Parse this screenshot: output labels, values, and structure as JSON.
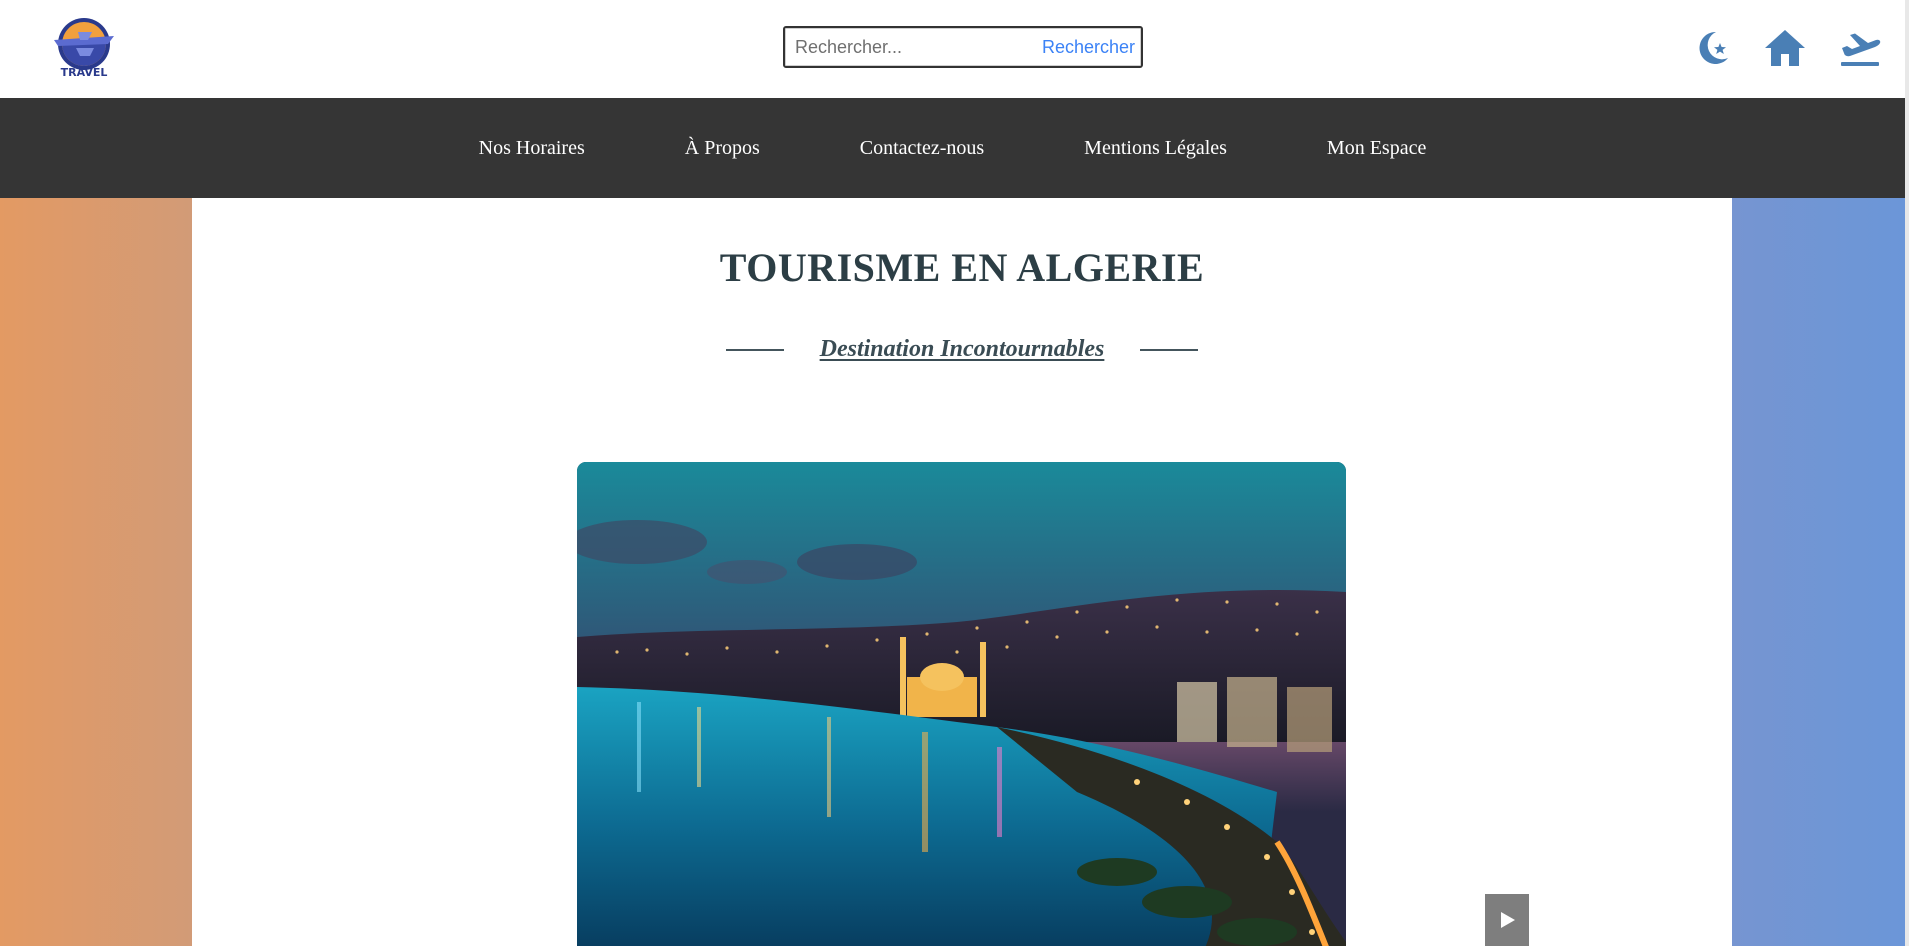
{
  "header": {
    "logo_text": "TRAVEL",
    "search": {
      "placeholder": "Rechercher...",
      "value": "",
      "button_label": "Rechercher"
    },
    "icons": [
      "moon-star-icon",
      "home-icon",
      "plane-departure-icon"
    ]
  },
  "nav": {
    "items": [
      {
        "label": "Nos Horaires"
      },
      {
        "label": "À Propos"
      },
      {
        "label": "Contactez-nous"
      },
      {
        "label": "Mentions Légales"
      },
      {
        "label": "Mon Espace"
      }
    ]
  },
  "main": {
    "title": "TOURISME EN ALGERIE",
    "subtitle": "Destination Incontournables"
  },
  "colors": {
    "navbar": "#353535",
    "accent_icons": "#4a7fb5",
    "search_button": "#3b82f6",
    "side_left": "#e39a63",
    "side_right": "#6b96d8",
    "title": "#2c3e45"
  }
}
